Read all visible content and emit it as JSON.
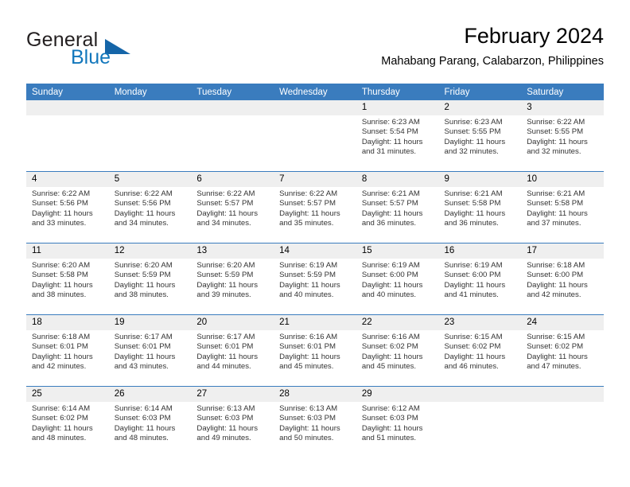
{
  "brand": {
    "name_part1": "General",
    "name_part2": "Blue",
    "logo_icon": "triangle-logo-icon",
    "accent_color": "#1565a8"
  },
  "header": {
    "month_title": "February 2024",
    "location": "Mahabang Parang, Calabarzon, Philippines"
  },
  "calendar": {
    "header_background": "#3a7cbe",
    "daynum_background": "#efefef",
    "weekday_headers": [
      "Sunday",
      "Monday",
      "Tuesday",
      "Wednesday",
      "Thursday",
      "Friday",
      "Saturday"
    ],
    "weeks": [
      [
        {
          "day": "",
          "lines": []
        },
        {
          "day": "",
          "lines": []
        },
        {
          "day": "",
          "lines": []
        },
        {
          "day": "",
          "lines": []
        },
        {
          "day": "1",
          "lines": [
            "Sunrise: 6:23 AM",
            "Sunset: 5:54 PM",
            "Daylight: 11 hours",
            "and 31 minutes."
          ]
        },
        {
          "day": "2",
          "lines": [
            "Sunrise: 6:23 AM",
            "Sunset: 5:55 PM",
            "Daylight: 11 hours",
            "and 32 minutes."
          ]
        },
        {
          "day": "3",
          "lines": [
            "Sunrise: 6:22 AM",
            "Sunset: 5:55 PM",
            "Daylight: 11 hours",
            "and 32 minutes."
          ]
        }
      ],
      [
        {
          "day": "4",
          "lines": [
            "Sunrise: 6:22 AM",
            "Sunset: 5:56 PM",
            "Daylight: 11 hours",
            "and 33 minutes."
          ]
        },
        {
          "day": "5",
          "lines": [
            "Sunrise: 6:22 AM",
            "Sunset: 5:56 PM",
            "Daylight: 11 hours",
            "and 34 minutes."
          ]
        },
        {
          "day": "6",
          "lines": [
            "Sunrise: 6:22 AM",
            "Sunset: 5:57 PM",
            "Daylight: 11 hours",
            "and 34 minutes."
          ]
        },
        {
          "day": "7",
          "lines": [
            "Sunrise: 6:22 AM",
            "Sunset: 5:57 PM",
            "Daylight: 11 hours",
            "and 35 minutes."
          ]
        },
        {
          "day": "8",
          "lines": [
            "Sunrise: 6:21 AM",
            "Sunset: 5:57 PM",
            "Daylight: 11 hours",
            "and 36 minutes."
          ]
        },
        {
          "day": "9",
          "lines": [
            "Sunrise: 6:21 AM",
            "Sunset: 5:58 PM",
            "Daylight: 11 hours",
            "and 36 minutes."
          ]
        },
        {
          "day": "10",
          "lines": [
            "Sunrise: 6:21 AM",
            "Sunset: 5:58 PM",
            "Daylight: 11 hours",
            "and 37 minutes."
          ]
        }
      ],
      [
        {
          "day": "11",
          "lines": [
            "Sunrise: 6:20 AM",
            "Sunset: 5:58 PM",
            "Daylight: 11 hours",
            "and 38 minutes."
          ]
        },
        {
          "day": "12",
          "lines": [
            "Sunrise: 6:20 AM",
            "Sunset: 5:59 PM",
            "Daylight: 11 hours",
            "and 38 minutes."
          ]
        },
        {
          "day": "13",
          "lines": [
            "Sunrise: 6:20 AM",
            "Sunset: 5:59 PM",
            "Daylight: 11 hours",
            "and 39 minutes."
          ]
        },
        {
          "day": "14",
          "lines": [
            "Sunrise: 6:19 AM",
            "Sunset: 5:59 PM",
            "Daylight: 11 hours",
            "and 40 minutes."
          ]
        },
        {
          "day": "15",
          "lines": [
            "Sunrise: 6:19 AM",
            "Sunset: 6:00 PM",
            "Daylight: 11 hours",
            "and 40 minutes."
          ]
        },
        {
          "day": "16",
          "lines": [
            "Sunrise: 6:19 AM",
            "Sunset: 6:00 PM",
            "Daylight: 11 hours",
            "and 41 minutes."
          ]
        },
        {
          "day": "17",
          "lines": [
            "Sunrise: 6:18 AM",
            "Sunset: 6:00 PM",
            "Daylight: 11 hours",
            "and 42 minutes."
          ]
        }
      ],
      [
        {
          "day": "18",
          "lines": [
            "Sunrise: 6:18 AM",
            "Sunset: 6:01 PM",
            "Daylight: 11 hours",
            "and 42 minutes."
          ]
        },
        {
          "day": "19",
          "lines": [
            "Sunrise: 6:17 AM",
            "Sunset: 6:01 PM",
            "Daylight: 11 hours",
            "and 43 minutes."
          ]
        },
        {
          "day": "20",
          "lines": [
            "Sunrise: 6:17 AM",
            "Sunset: 6:01 PM",
            "Daylight: 11 hours",
            "and 44 minutes."
          ]
        },
        {
          "day": "21",
          "lines": [
            "Sunrise: 6:16 AM",
            "Sunset: 6:01 PM",
            "Daylight: 11 hours",
            "and 45 minutes."
          ]
        },
        {
          "day": "22",
          "lines": [
            "Sunrise: 6:16 AM",
            "Sunset: 6:02 PM",
            "Daylight: 11 hours",
            "and 45 minutes."
          ]
        },
        {
          "day": "23",
          "lines": [
            "Sunrise: 6:15 AM",
            "Sunset: 6:02 PM",
            "Daylight: 11 hours",
            "and 46 minutes."
          ]
        },
        {
          "day": "24",
          "lines": [
            "Sunrise: 6:15 AM",
            "Sunset: 6:02 PM",
            "Daylight: 11 hours",
            "and 47 minutes."
          ]
        }
      ],
      [
        {
          "day": "25",
          "lines": [
            "Sunrise: 6:14 AM",
            "Sunset: 6:02 PM",
            "Daylight: 11 hours",
            "and 48 minutes."
          ]
        },
        {
          "day": "26",
          "lines": [
            "Sunrise: 6:14 AM",
            "Sunset: 6:03 PM",
            "Daylight: 11 hours",
            "and 48 minutes."
          ]
        },
        {
          "day": "27",
          "lines": [
            "Sunrise: 6:13 AM",
            "Sunset: 6:03 PM",
            "Daylight: 11 hours",
            "and 49 minutes."
          ]
        },
        {
          "day": "28",
          "lines": [
            "Sunrise: 6:13 AM",
            "Sunset: 6:03 PM",
            "Daylight: 11 hours",
            "and 50 minutes."
          ]
        },
        {
          "day": "29",
          "lines": [
            "Sunrise: 6:12 AM",
            "Sunset: 6:03 PM",
            "Daylight: 11 hours",
            "and 51 minutes."
          ]
        },
        {
          "day": "",
          "lines": []
        },
        {
          "day": "",
          "lines": []
        }
      ]
    ]
  }
}
